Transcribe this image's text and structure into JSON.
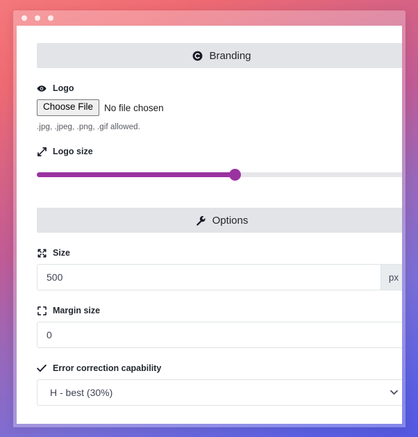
{
  "window": {
    "dots": [
      "close-dot",
      "minimize-dot",
      "maximize-dot"
    ]
  },
  "colors": {
    "accent_purple": "#9b32a0",
    "section_header_bg": "#e3e4e8",
    "input_border": "#dee2e6",
    "addon_bg": "#e9ecef",
    "text_dark": "#23272f",
    "gradient_start": "#f4787c",
    "gradient_mid": "#9a67b8",
    "gradient_end": "#5457e0"
  },
  "branding_section": {
    "header": {
      "label": "Branding",
      "icon": "copyright-circle-icon"
    },
    "logo_field": {
      "label": "Logo",
      "icon": "eye-icon",
      "button_label": "Choose File",
      "file_status": "No file chosen",
      "help_text": ".jpg, .jpeg, .png, .gif allowed."
    },
    "logo_size_field": {
      "label": "Logo size",
      "icon": "resize-diagonal-icon",
      "slider_percent": 53.5
    }
  },
  "options_section": {
    "header": {
      "label": "Options",
      "icon": "wrench-icon"
    },
    "size_field": {
      "label": "Size",
      "icon": "arrows-expand-icon",
      "value": "500",
      "placeholder": "Size",
      "unit": "px"
    },
    "margin_field": {
      "label": "Margin size",
      "icon": "crop-corners-icon",
      "value": "0",
      "placeholder": "Margin size"
    },
    "error_correction_field": {
      "label": "Error correction capability",
      "icon": "check-icon",
      "selected": "H - best (30%)",
      "chevron_icon": "chevron-down-icon"
    }
  }
}
